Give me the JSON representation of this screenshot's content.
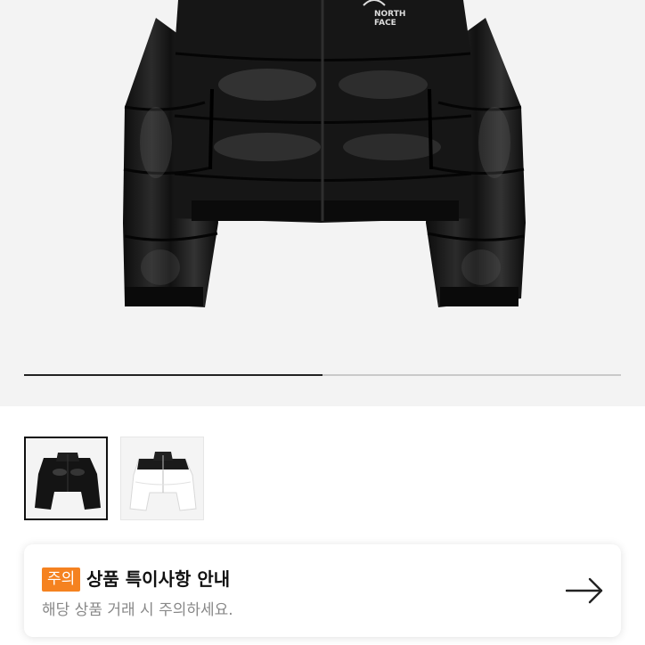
{
  "product": {
    "brand_logo_text": [
      "NORTH",
      "FACE"
    ],
    "gallery": {
      "current_image": 1,
      "total_images": 2,
      "progress": 0.5
    },
    "thumbnails": [
      {
        "name": "black-jacket",
        "selected": true
      },
      {
        "name": "white-black-jacket",
        "selected": false
      }
    ]
  },
  "notice": {
    "badge": "주의",
    "title": "상품 특이사항 안내",
    "subtitle": "해당 상품 거래 시 주의하세요.",
    "icon": "arrow-right-icon"
  },
  "colors": {
    "badge_bg": "#f58220",
    "progress_fill": "#222222",
    "progress_track": "#c9c9c9"
  }
}
